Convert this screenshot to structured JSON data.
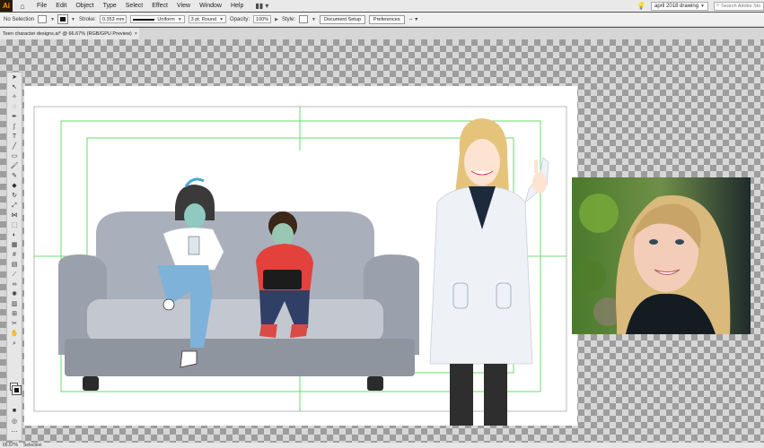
{
  "app": {
    "logo": "Ai",
    "menus": [
      "File",
      "Edit",
      "Object",
      "Type",
      "Select",
      "Effect",
      "View",
      "Window",
      "Help"
    ]
  },
  "menubar": {
    "workspace": "april 2018 drawing",
    "search_placeholder": "Search Adobe Sto"
  },
  "control": {
    "selection": "No Selection",
    "stroke_label": "Stroke:",
    "stroke_weight": "0.353 mm",
    "profile": "Uniform",
    "brush": "3 pt. Round",
    "opacity_label": "Opacity:",
    "opacity": "100%",
    "style_label": "Style:",
    "doc_setup": "Document Setup",
    "preferences": "Preferences"
  },
  "document": {
    "tab_title": "Teen character designs.ai* @ 66.67% (RGB/GPU Preview)"
  },
  "status": {
    "zoom": "66.67%",
    "tool": "Selection"
  },
  "colors": {
    "guide": "#41d44a",
    "sofa": "#a9b0bc",
    "sofa_dark": "#8e959f",
    "accent": "#ff9a00"
  },
  "icons": [
    "home-icon",
    "lightbulb-icon",
    "search-icon",
    "workspace-switcher-icon",
    "selection-tool-icon"
  ]
}
